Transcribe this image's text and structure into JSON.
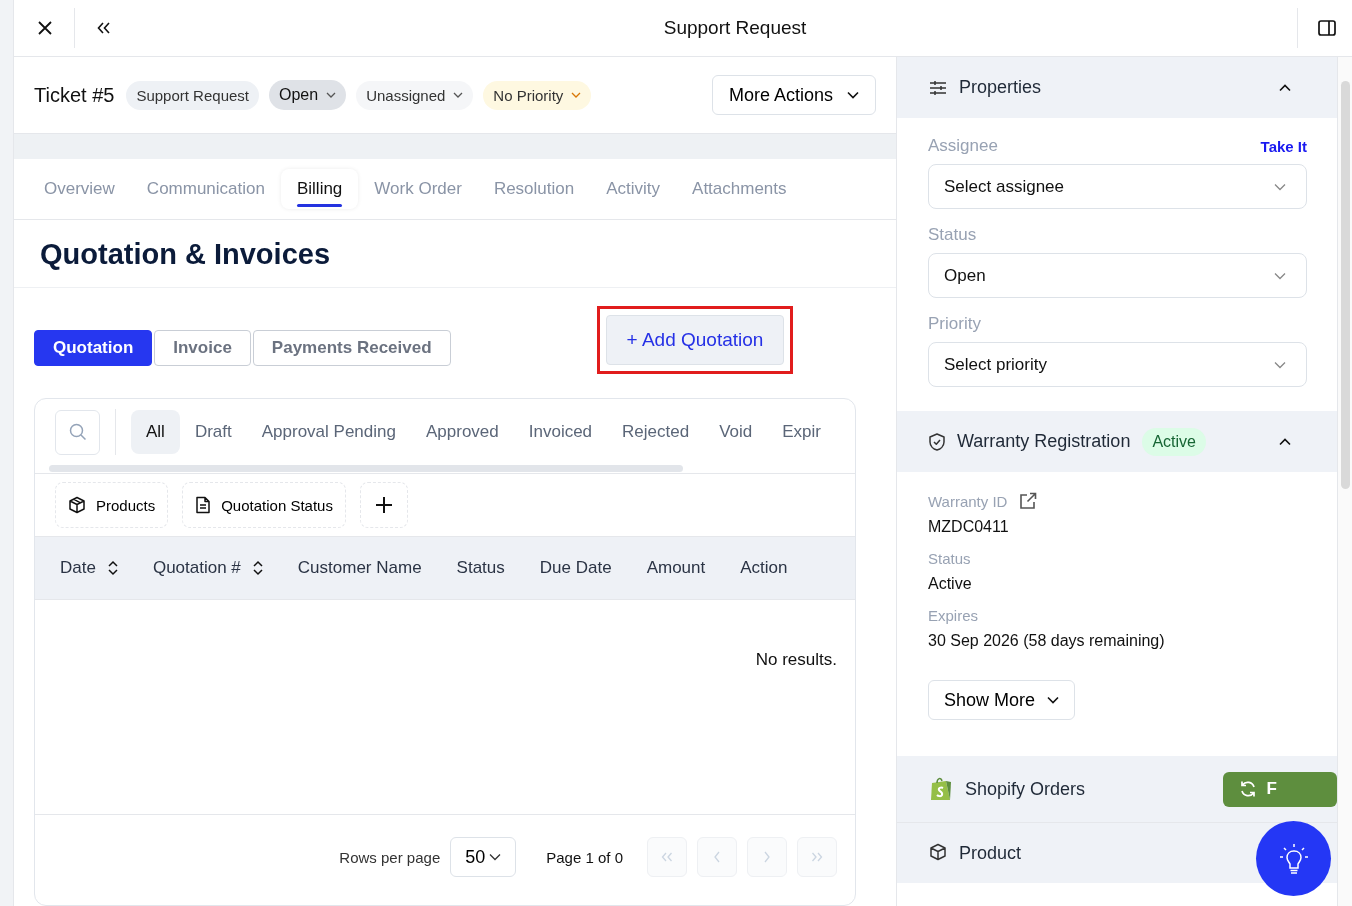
{
  "window": {
    "title": "Support Request"
  },
  "ticket": {
    "title": "Ticket #5",
    "chips": [
      {
        "label": "Support Request",
        "kind": "type",
        "dropdown": false
      },
      {
        "label": "Open",
        "kind": "status",
        "dropdown": true
      },
      {
        "label": "Unassigned",
        "kind": "assignee",
        "dropdown": true
      },
      {
        "label": "No Priority",
        "kind": "priority",
        "dropdown": true
      }
    ],
    "more_actions": "More Actions"
  },
  "tabs": [
    {
      "label": "Overview",
      "selected": false
    },
    {
      "label": "Communication",
      "selected": false
    },
    {
      "label": "Billing",
      "selected": true
    },
    {
      "label": "Work Order",
      "selected": false
    },
    {
      "label": "Resolution",
      "selected": false
    },
    {
      "label": "Activity",
      "selected": false
    },
    {
      "label": "Attachments",
      "selected": false
    }
  ],
  "billing": {
    "heading": "Quotation & Invoices",
    "segments": [
      {
        "label": "Quotation",
        "selected": true
      },
      {
        "label": "Invoice",
        "selected": false
      },
      {
        "label": "Payments Received",
        "selected": false
      }
    ],
    "add_button": "+ Add Quotation",
    "filters": [
      {
        "label": "All",
        "selected": true
      },
      {
        "label": "Draft",
        "selected": false
      },
      {
        "label": "Approval Pending",
        "selected": false
      },
      {
        "label": "Approved",
        "selected": false
      },
      {
        "label": "Invoiced",
        "selected": false
      },
      {
        "label": "Rejected",
        "selected": false
      },
      {
        "label": "Void",
        "selected": false
      },
      {
        "label": "Expir",
        "selected": false
      }
    ],
    "chips": [
      {
        "label": "Products",
        "kind": "box"
      },
      {
        "label": "Quotation Status",
        "kind": "document"
      }
    ],
    "columns": [
      {
        "label": "Date",
        "sortable": true
      },
      {
        "label": "Quotation #",
        "sortable": true
      },
      {
        "label": "Customer Name",
        "sortable": false
      },
      {
        "label": "Status",
        "sortable": false
      },
      {
        "label": "Due Date",
        "sortable": false
      },
      {
        "label": "Amount",
        "sortable": false
      },
      {
        "label": "Action",
        "sortable": false
      }
    ],
    "empty": "No results.",
    "pagination": {
      "rows_label": "Rows per page",
      "rows_value": "50",
      "page": "Page 1 of 0"
    }
  },
  "properties": {
    "title": "Properties",
    "fields": [
      {
        "label": "Assignee",
        "value": "Select assignee",
        "action": "Take It"
      },
      {
        "label": "Status",
        "value": "Open"
      },
      {
        "label": "Priority",
        "value": "Select priority"
      }
    ]
  },
  "warranty": {
    "title": "Warranty Registration",
    "badge": "Active",
    "items": [
      {
        "label": "Warranty ID",
        "value": "MZDC0411",
        "link": true
      },
      {
        "label": "Status",
        "value": "Active",
        "link": false
      },
      {
        "label": "Expires",
        "value": "30 Sep 2026 (58 days remaining)",
        "link": false
      }
    ],
    "show_more": "Show More"
  },
  "shopify": {
    "title": "Shopify Orders",
    "button": "F"
  },
  "product": {
    "title": "Product"
  }
}
